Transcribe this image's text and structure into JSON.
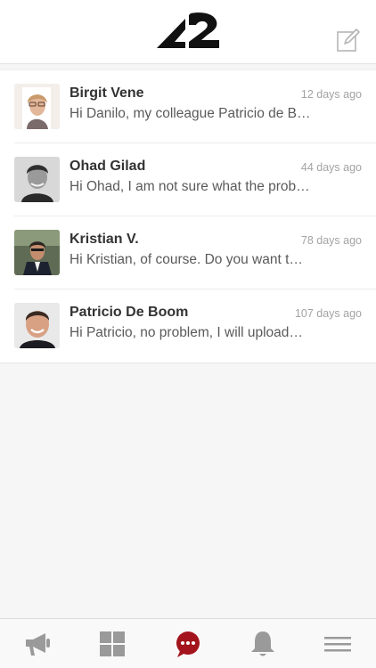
{
  "header": {
    "logo_icon": "42-logo",
    "compose_icon": "compose-icon"
  },
  "conversations": [
    {
      "name": "Birgit Vene",
      "time": "12 days ago",
      "preview": "Hi Danilo, my colleague Patricio de B…"
    },
    {
      "name": "Ohad Gilad",
      "time": "44 days ago",
      "preview": "Hi Ohad, I am not sure what the prob…"
    },
    {
      "name": "Kristian V.",
      "time": "78 days ago",
      "preview": "Hi Kristian, of course. Do you want t…"
    },
    {
      "name": "Patricio De Boom",
      "time": "107 days ago",
      "preview": "Hi Patricio, no problem, I will upload…"
    }
  ],
  "tabbar": {
    "tabs": [
      {
        "icon": "megaphone-icon",
        "active": false
      },
      {
        "icon": "grid-icon",
        "active": false
      },
      {
        "icon": "chat-icon",
        "active": true
      },
      {
        "icon": "bell-icon",
        "active": false
      },
      {
        "icon": "menu-icon",
        "active": false
      }
    ],
    "active_color": "#a3141c",
    "inactive_color": "#9a9a9a"
  }
}
